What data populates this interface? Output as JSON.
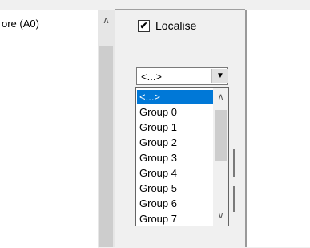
{
  "left_list": {
    "item": "ore (A0)",
    "scroll_up_icon": "chevron-up-icon"
  },
  "checkbox": {
    "checked_mark": "✔",
    "label": "Localise"
  },
  "combo": {
    "value": "<...>",
    "button_icon": "triangle-down-icon"
  },
  "dropdown": {
    "options": [
      "<...>",
      "Group 0",
      "Group 1",
      "Group 2",
      "Group 3",
      "Group 4",
      "Group 5",
      "Group 6",
      "Group 7"
    ],
    "selected_index": 0,
    "scroll_up_icon": "chevron-up-icon",
    "scroll_down_icon": "chevron-down-icon"
  }
}
